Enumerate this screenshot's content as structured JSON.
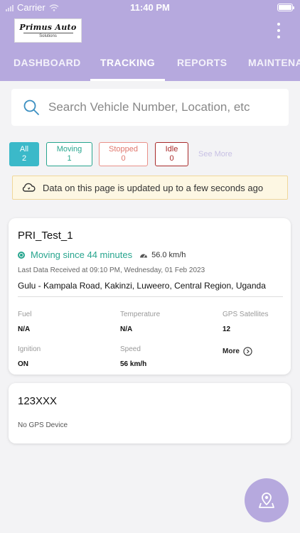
{
  "status_bar": {
    "carrier": "Carrier",
    "time": "11:40 PM"
  },
  "header": {
    "logo": {
      "main": "Primus Auto",
      "sub": "Solutions"
    },
    "tabs": [
      {
        "label": "DASHBOARD",
        "active": false
      },
      {
        "label": "TRACKING",
        "active": true
      },
      {
        "label": "REPORTS",
        "active": false
      },
      {
        "label": "MAINTENA",
        "active": false
      }
    ]
  },
  "search": {
    "placeholder": "Search Vehicle Number, Location, etc",
    "value": ""
  },
  "filters": [
    {
      "label": "All",
      "count": "2",
      "selected": true
    },
    {
      "label": "Moving",
      "count": "1"
    },
    {
      "label": "Stopped",
      "count": "0"
    },
    {
      "label": "Idle",
      "count": "0"
    }
  ],
  "see_more": "See More",
  "notice": "Data on this page is updated up to a few seconds ago",
  "vehicles": [
    {
      "name": "PRI_Test_1",
      "status": "Moving since 44 minutes",
      "speed": "56.0 km/h",
      "last_data": "Last Data Received at 09:10 PM, Wednesday, 01 Feb 2023",
      "address": "Gulu - Kampala Road, Kakinzi, Luweero, Central Region, Uganda",
      "details": {
        "fuel_label": "Fuel",
        "fuel": "N/A",
        "temperature_label": "Temperature",
        "temperature": "N/A",
        "gps_label": "GPS Satellites",
        "gps": "12",
        "ignition_label": "Ignition",
        "ignition": "ON",
        "speed_label": "Speed",
        "speed": "56 km/h",
        "more_label": "More"
      }
    },
    {
      "name": "123XXX",
      "status": "No GPS Device"
    }
  ],
  "colors": {
    "header": "#b6a9de",
    "all_filter": "#3bb9c9",
    "moving": "#27a58e",
    "stopped": "#e0776d",
    "idle": "#a82a2a",
    "notice_bg": "#fdf7e3"
  }
}
